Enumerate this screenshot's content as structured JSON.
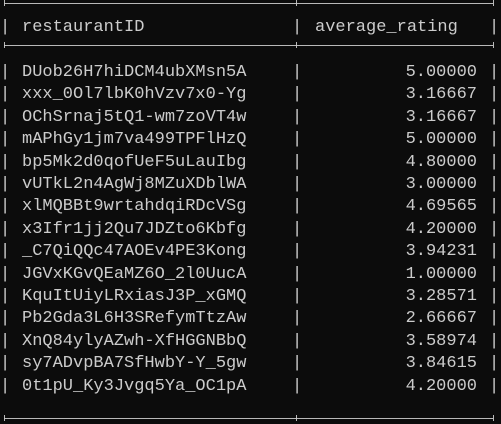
{
  "table": {
    "columns": [
      "restaurantID",
      "average_rating"
    ],
    "rows": [
      [
        "DUob26H7hiDCM4ubXMsn5A",
        "5.00000"
      ],
      [
        "xxx_0Ol7lbK0hVzv7x0-Yg",
        "3.16667"
      ],
      [
        "OChSrnaj5tQ1-wm7zoVT4w",
        "3.16667"
      ],
      [
        "mAPhGy1jm7va499TPFlHzQ",
        "5.00000"
      ],
      [
        "bp5Mk2d0qofUeF5uLauIbg",
        "4.80000"
      ],
      [
        "vUTkL2n4AgWj8MZuXDblWA",
        "3.00000"
      ],
      [
        "xlMQBBt9wrtahdqiRDcVSg",
        "4.69565"
      ],
      [
        "x3Ifr1jj2Qu7JDZto6Kbfg",
        "4.20000"
      ],
      [
        "_C7QiQQc47AOEv4PE3Kong",
        "3.94231"
      ],
      [
        "JGVxKGvQEaMZ6O_2l0UucA",
        "1.00000"
      ],
      [
        "KquItUiyLRxiasJ3P_xGMQ",
        "3.28571"
      ],
      [
        "Pb2Gda3L6H3SRefymTtzAw",
        "2.66667"
      ],
      [
        "XnQ84ylyAZwh-XfHGGNBbQ",
        "3.58974"
      ],
      [
        "sy7ADvpBA7SfHwbY-Y_5gw",
        "3.84615"
      ],
      [
        "0t1pU_Ky3Jvgq5Ya_OC1pA",
        "4.20000"
      ]
    ]
  },
  "separators": {
    "pipe": "|"
  }
}
